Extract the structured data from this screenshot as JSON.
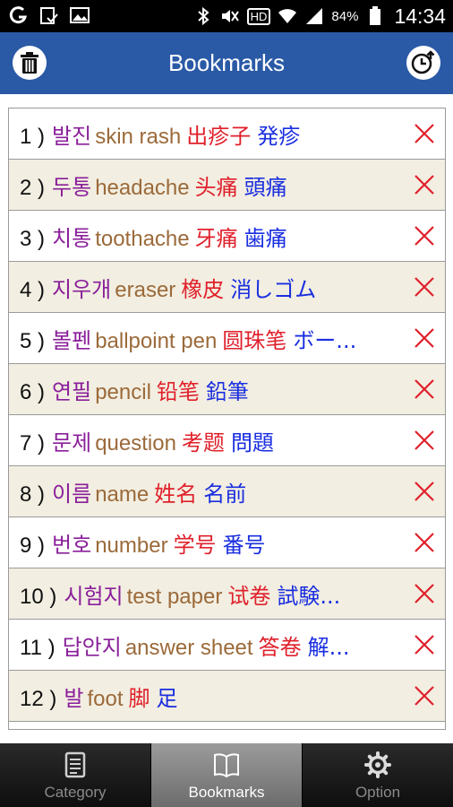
{
  "status_bar": {
    "battery": "84%",
    "time": "14:34",
    "network_badge": "HD"
  },
  "header": {
    "title": "Bookmarks",
    "left_icon": "trash-icon",
    "right_icon": "history-icon"
  },
  "colors": {
    "header_bg": "#2a5aa6",
    "korean": "#8a1f9a",
    "english": "#9b6a3a",
    "chinese": "#e0202b",
    "japanese": "#1a2ee0",
    "delete": "#e0202b"
  },
  "bookmarks": [
    {
      "index": "1 )",
      "korean": "발진",
      "english": "skin rash",
      "chinese": "出疹子",
      "japanese": "発疹"
    },
    {
      "index": "2 )",
      "korean": "두통",
      "english": "headache",
      "chinese": "头痛",
      "japanese": "頭痛"
    },
    {
      "index": "3 )",
      "korean": "치통",
      "english": "toothache",
      "chinese": "牙痛",
      "japanese": "歯痛"
    },
    {
      "index": "4 )",
      "korean": "지우개",
      "english": "eraser",
      "chinese": "橡皮",
      "japanese": "消しゴム"
    },
    {
      "index": "5 )",
      "korean": "볼펜",
      "english": "ballpoint pen",
      "chinese": "圆珠笔",
      "japanese": "ボー..."
    },
    {
      "index": "6 )",
      "korean": "연필",
      "english": "pencil",
      "chinese": "铅笔",
      "japanese": "鉛筆"
    },
    {
      "index": "7 )",
      "korean": "문제",
      "english": "question",
      "chinese": "考题",
      "japanese": "問題"
    },
    {
      "index": "8 )",
      "korean": "이름",
      "english": "name",
      "chinese": "姓名",
      "japanese": "名前"
    },
    {
      "index": "9 )",
      "korean": "번호",
      "english": "number",
      "chinese": "学号",
      "japanese": "番号"
    },
    {
      "index": "10 )",
      "korean": "시험지",
      "english": "test paper",
      "chinese": "试卷",
      "japanese": "試験..."
    },
    {
      "index": "11 )",
      "korean": "답안지",
      "english": "answer sheet",
      "chinese": "答卷",
      "japanese": "解..."
    },
    {
      "index": "12 )",
      "korean": "발",
      "english": "foot",
      "chinese": "脚",
      "japanese": "足"
    }
  ],
  "bottom_nav": {
    "tabs": [
      {
        "label": "Category",
        "icon": "document-icon",
        "active": false
      },
      {
        "label": "Bookmarks",
        "icon": "book-icon",
        "active": true
      },
      {
        "label": "Option",
        "icon": "gear-icon",
        "active": false
      }
    ]
  }
}
